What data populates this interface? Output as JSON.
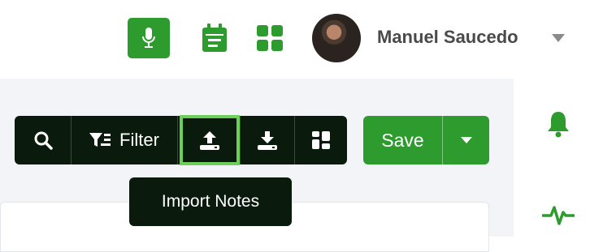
{
  "header": {
    "user_name": "Manuel Saucedo",
    "icons": [
      "microphone-icon",
      "calendar-icon",
      "apps-grid-icon",
      "chevron-down-icon"
    ]
  },
  "toolbar": {
    "filter_label": "Filter",
    "save_label": "Save",
    "icons": [
      "search-icon",
      "filter-icon",
      "upload-icon",
      "download-icon",
      "layout-icon",
      "caret-down-icon"
    ]
  },
  "tooltip": {
    "text": "Import Notes"
  },
  "rail": {
    "icons": [
      "bell-icon",
      "activity-icon"
    ]
  },
  "colors": {
    "brand_green": "#2e9b2e",
    "toolbar_dark": "#0a1a0c",
    "highlight_green": "#6ccf5a",
    "workspace_bg": "#f3f4f8"
  }
}
